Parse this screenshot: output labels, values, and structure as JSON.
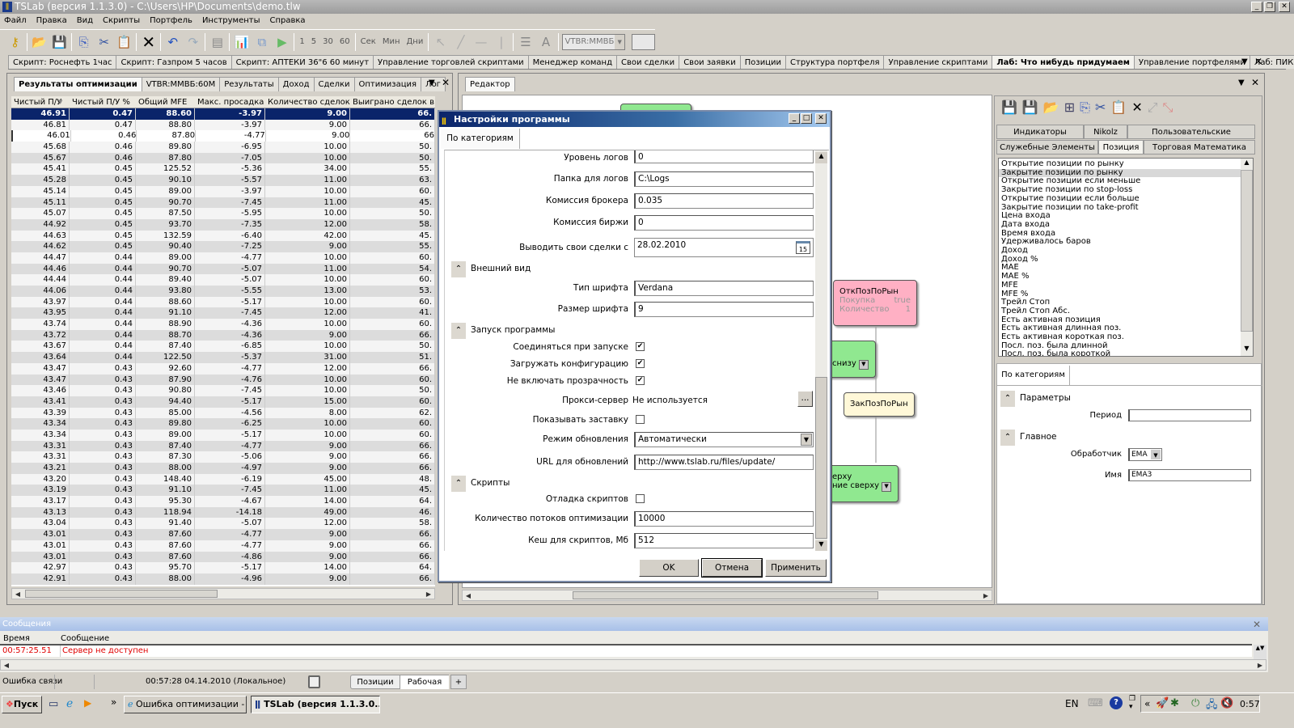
{
  "window": {
    "title": "TSLab (версия 1.1.3.0) - C:\\Users\\HP\\Documents\\demo.tlw"
  },
  "menu": [
    "Файл",
    "Правка",
    "Вид",
    "Скрипты",
    "Портфель",
    "Инструменты",
    "Справка"
  ],
  "toolbar": {
    "intervals": [
      "1",
      "5",
      "30",
      "60"
    ],
    "units": [
      "Сек",
      "Мин",
      "Дни"
    ],
    "instrument": "VTBR:MMBБ"
  },
  "doc_tabs": [
    "Скрипт: Роснефть 1час",
    "Скрипт: Газпром 5 часов",
    "Скрипт: АПТЕКИ 36\"6 60 минут",
    "Управление торговлей скриптами",
    "Менеджер команд",
    "Свои сделки",
    "Свои заявки",
    "Позиции",
    "Структура портфеля",
    "Управление скриптами",
    "Лаб: Что нибудь придумаем",
    "Управление портфелями",
    "Лаб: ПИК"
  ],
  "doc_tabs_active": 10,
  "left_panel": {
    "tabs": [
      "Результаты оптимизации",
      "VTBR:MMBБ:60M",
      "Результаты",
      "Доход",
      "Сделки",
      "Оптимизация",
      "Лог"
    ],
    "columns": [
      "Чистый П/У",
      "Чистый П/У %",
      "Общий MFE",
      "Макс. просадка",
      "Количество сделок",
      "Выиграно сделок в %"
    ],
    "sort_icon": "sort-desc-icon",
    "rows": [
      [
        "46.91",
        "0.47",
        "88.60",
        "-3.97",
        "9.00",
        "66."
      ],
      [
        "46.81",
        "0.47",
        "88.80",
        "-3.97",
        "9.00",
        "66."
      ],
      [
        "46.01",
        "0.46",
        "87.80",
        "-4.77",
        "9.00",
        "66"
      ],
      [
        "45.68",
        "0.46",
        "89.80",
        "-6.95",
        "10.00",
        "50."
      ],
      [
        "45.67",
        "0.46",
        "87.80",
        "-7.05",
        "10.00",
        "50."
      ],
      [
        "45.41",
        "0.45",
        "125.52",
        "-5.36",
        "34.00",
        "55."
      ],
      [
        "45.28",
        "0.45",
        "90.10",
        "-5.57",
        "11.00",
        "63."
      ],
      [
        "45.14",
        "0.45",
        "89.00",
        "-3.97",
        "10.00",
        "60."
      ],
      [
        "45.11",
        "0.45",
        "90.70",
        "-7.45",
        "11.00",
        "45."
      ],
      [
        "45.07",
        "0.45",
        "87.50",
        "-5.95",
        "10.00",
        "50."
      ],
      [
        "44.92",
        "0.45",
        "93.70",
        "-7.35",
        "12.00",
        "58."
      ],
      [
        "44.63",
        "0.45",
        "132.59",
        "-6.40",
        "42.00",
        "45."
      ],
      [
        "44.62",
        "0.45",
        "90.40",
        "-7.25",
        "9.00",
        "55."
      ],
      [
        "44.47",
        "0.44",
        "89.00",
        "-4.77",
        "10.00",
        "60."
      ],
      [
        "44.46",
        "0.44",
        "90.70",
        "-5.07",
        "11.00",
        "54."
      ],
      [
        "44.44",
        "0.44",
        "89.40",
        "-5.07",
        "10.00",
        "60."
      ],
      [
        "44.06",
        "0.44",
        "93.80",
        "-5.55",
        "13.00",
        "53."
      ],
      [
        "43.97",
        "0.44",
        "88.60",
        "-5.17",
        "10.00",
        "60."
      ],
      [
        "43.95",
        "0.44",
        "91.10",
        "-7.45",
        "12.00",
        "41."
      ],
      [
        "43.74",
        "0.44",
        "88.90",
        "-4.36",
        "10.00",
        "60."
      ],
      [
        "43.72",
        "0.44",
        "88.70",
        "-4.36",
        "9.00",
        "66."
      ],
      [
        "43.67",
        "0.44",
        "87.40",
        "-6.85",
        "10.00",
        "50."
      ],
      [
        "43.64",
        "0.44",
        "122.50",
        "-5.37",
        "31.00",
        "51."
      ],
      [
        "43.47",
        "0.43",
        "92.60",
        "-4.77",
        "12.00",
        "66."
      ],
      [
        "43.47",
        "0.43",
        "87.90",
        "-4.76",
        "10.00",
        "60."
      ],
      [
        "43.46",
        "0.43",
        "90.80",
        "-7.45",
        "10.00",
        "50."
      ],
      [
        "43.41",
        "0.43",
        "94.40",
        "-5.17",
        "15.00",
        "60."
      ],
      [
        "43.39",
        "0.43",
        "85.00",
        "-4.56",
        "8.00",
        "62."
      ],
      [
        "43.34",
        "0.43",
        "89.80",
        "-6.25",
        "10.00",
        "60."
      ],
      [
        "43.34",
        "0.43",
        "89.00",
        "-5.17",
        "10.00",
        "60."
      ],
      [
        "43.31",
        "0.43",
        "87.40",
        "-4.77",
        "9.00",
        "66."
      ],
      [
        "43.31",
        "0.43",
        "87.30",
        "-5.06",
        "9.00",
        "66."
      ],
      [
        "43.21",
        "0.43",
        "88.00",
        "-4.97",
        "9.00",
        "66."
      ],
      [
        "43.20",
        "0.43",
        "148.40",
        "-6.19",
        "45.00",
        "48."
      ],
      [
        "43.19",
        "0.43",
        "91.10",
        "-7.45",
        "11.00",
        "45."
      ],
      [
        "43.17",
        "0.43",
        "95.30",
        "-4.67",
        "14.00",
        "64."
      ],
      [
        "43.13",
        "0.43",
        "118.94",
        "-14.18",
        "49.00",
        "46."
      ],
      [
        "43.04",
        "0.43",
        "91.40",
        "-5.07",
        "12.00",
        "58."
      ],
      [
        "43.01",
        "0.43",
        "87.60",
        "-4.77",
        "9.00",
        "66."
      ],
      [
        "43.01",
        "0.43",
        "87.60",
        "-4.77",
        "9.00",
        "66."
      ],
      [
        "43.01",
        "0.43",
        "87.60",
        "-4.86",
        "9.00",
        "66."
      ],
      [
        "42.97",
        "0.43",
        "95.70",
        "-5.17",
        "14.00",
        "64."
      ],
      [
        "42.91",
        "0.43",
        "88.00",
        "-4.96",
        "9.00",
        "66."
      ]
    ],
    "selected_row": 0
  },
  "editor": {
    "tab": "Редактор",
    "nodes": {
      "open": {
        "title": "ОткПозПоРын",
        "p1": "Покупка",
        "v1": "true",
        "p2": "Количество",
        "v2": "1"
      },
      "close": {
        "title": "ЗакПозПоРын"
      },
      "green1": "снизу",
      "green2a": "ерху",
      "green2b": "ние сверху"
    },
    "tool_tabs_row1": [
      "Индикаторы",
      "Nikolz",
      "Пользовательские"
    ],
    "tool_tabs_row2": [
      "Служебные Элементы",
      "Позиция",
      "Торговая Математика"
    ],
    "tool_tab_active": "Позиция",
    "tool_items": [
      "Открытие позиции по рынку",
      "Закрытие позиции по рынку",
      "Открытие позиции если меньше",
      "Закрытие позиции по stop-loss",
      "Открытие позиции если больше",
      "Закрытие позиции по take-profit",
      "Цена входа",
      "Дата входа",
      "Время входа",
      "Удерживалось баров",
      "Доход",
      "Доход %",
      "MAE",
      "MAE %",
      "MFE",
      "MFE %",
      "Трейл Стоп",
      "Трейл Стоп Абс.",
      "Есть активная позиция",
      "Есть активная длинная поз.",
      "Есть активная короткая поз.",
      "Посл. поз. была длинной",
      "Посл. поз. была короткой"
    ],
    "tool_selected": 1,
    "props": {
      "tab": "По категориям",
      "cat1": "Параметры",
      "period_label": "Период",
      "period_value": "",
      "cat2": "Главное",
      "handler_label": "Обработчик",
      "handler_value": "EMA",
      "name_label": "Имя",
      "name_value": "EMA3"
    }
  },
  "dialog": {
    "title": "Настройки программы",
    "tab": "По категориям",
    "log_level": {
      "label": "Уровень логов",
      "value": "0"
    },
    "log_folder": {
      "label": "Папка для логов",
      "value": "C:\\Logs"
    },
    "broker_fee": {
      "label": "Комиссия брокера",
      "value": "0.035"
    },
    "exchange_fee": {
      "label": "Комиссия биржи",
      "value": "0"
    },
    "trades_from": {
      "label": "Выводить свои сделки с",
      "value": "28.02.2010",
      "cal": "15"
    },
    "cat_appearance": "Внешний вид",
    "font_type": {
      "label": "Тип шрифта",
      "value": "Verdana"
    },
    "font_size": {
      "label": "Размер шрифта",
      "value": "9"
    },
    "cat_startup": "Запуск программы",
    "connect": {
      "label": "Соединяться при запуске",
      "checked": true
    },
    "load_config": {
      "label": "Загружать конфигурацию",
      "checked": true
    },
    "no_transparency": {
      "label": "Не включать прозрачность",
      "checked": true
    },
    "proxy": {
      "label": "Прокси-сервер",
      "value": "Не используется",
      "btn": "..."
    },
    "splash": {
      "label": "Показывать заставку",
      "checked": false
    },
    "update_mode": {
      "label": "Режим обновления",
      "value": "Автоматически"
    },
    "update_url": {
      "label": "URL для обновлений",
      "value": "http://www.tslab.ru/files/update/"
    },
    "cat_scripts": "Скрипты",
    "debug": {
      "label": "Отладка скриптов",
      "checked": false
    },
    "threads": {
      "label": "Количество потоков оптимизации",
      "value": "10000"
    },
    "cache": {
      "label": "Кеш для скриптов, Мб",
      "value": "512"
    },
    "ok": "OK",
    "cancel": "Отмена",
    "apply": "Применить"
  },
  "messages": {
    "title": "Сообщения",
    "col_time": "Время",
    "col_msg": "Сообщение",
    "rows": [
      {
        "time": "00:57:25.51",
        "text": "Сервер не доступен"
      }
    ],
    "error_color": "#e00000"
  },
  "status": {
    "connection": "Ошибка связи",
    "time": "00:57:28 04.14.2010 (Локальное)",
    "tabs": [
      "Позиции",
      "Рабочая"
    ],
    "add": "+"
  },
  "taskbar": {
    "start": "Пуск",
    "more": "»",
    "items": [
      "Ошибка оптимизации - ...",
      "TSLab (версия 1.1.3.0..."
    ],
    "lang": "EN",
    "tray_more": "«",
    "clock": "0:57"
  }
}
